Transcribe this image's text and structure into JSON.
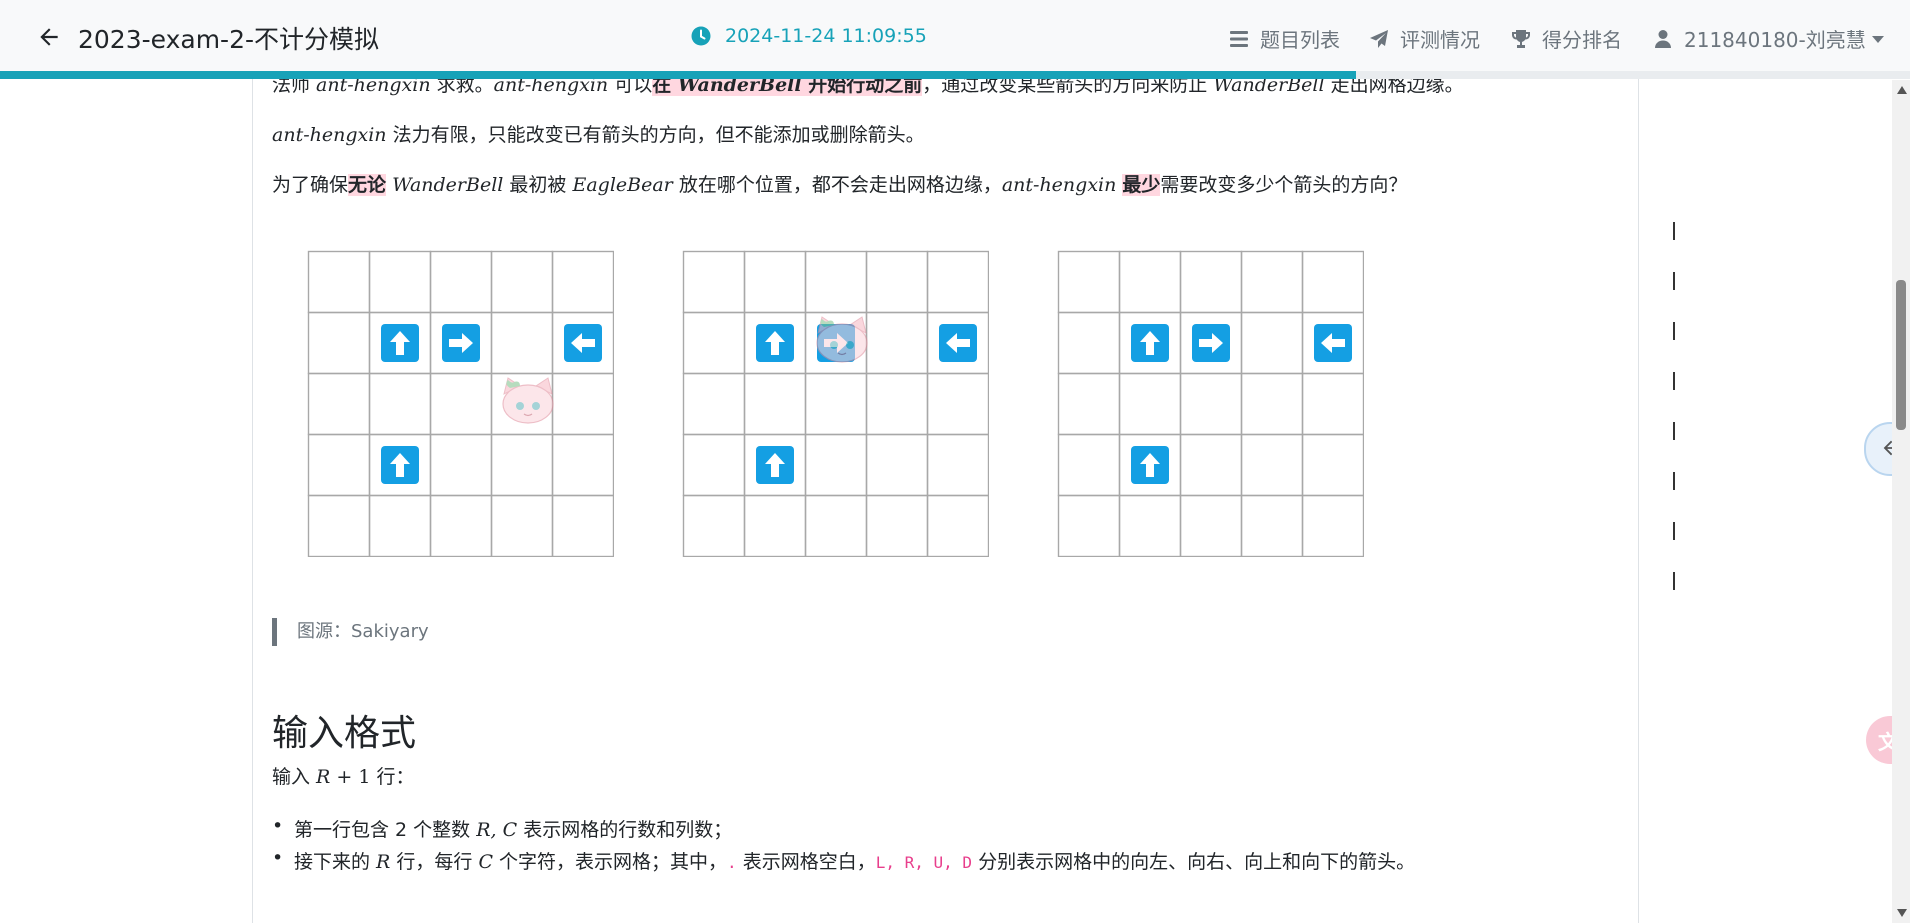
{
  "header": {
    "title": "2023-exam-2-不计分模拟",
    "clock": "2024-11-24 11:09:55",
    "nav": {
      "problems": "题目列表",
      "judge": "评测情况",
      "rank": "得分排名",
      "user": "211840180-刘亮慧"
    },
    "progress_fraction": 0.71
  },
  "problem": {
    "p1": {
      "a": "法师 ",
      "b": "ant-hengxin",
      "c": " 求救。",
      "d": "ant-hengxin",
      "e": " 可以",
      "f": "在 ",
      "g": "WanderBell",
      "h": " 开始行动之前",
      "i": "，通过改变某些箭头的方向来防止 ",
      "j": "WanderBell",
      "k": " 走出网格边缘。"
    },
    "p2": {
      "a": "ant-hengxin",
      "b": " 法力有限，只能改变已有箭头的方向，但不能添加或删除箭头。"
    },
    "p3": {
      "a": "为了确保",
      "b": "无论",
      "c": " ",
      "d": "WanderBell",
      "e": " 最初被 ",
      "f": "EagleBear",
      "g": " 放在哪个位置，都不会走出网格边缘，",
      "h": "ant-hengxin",
      "i": " ",
      "j": "最少",
      "k": "需要改变多少个箭头的方向？"
    },
    "image_caption": "图源：Sakiyary",
    "input_heading": "输入格式",
    "input_line": {
      "a": "输入 ",
      "b": "R",
      "c": " + 1",
      "d": " 行："
    },
    "bullets": {
      "b1": {
        "a": "第一行包含 2 个整数 ",
        "b": "R, C",
        "c": " 表示网格的行数和列数；"
      },
      "b2": {
        "a": "接下来的 ",
        "b": "R",
        "c": " 行，每行 ",
        "d": "C",
        "e": " 个字符，表示网格；其中，",
        "f": ".",
        "g": " 表示网格空白，",
        "h": "L, R, U, D",
        "i": " 分别表示网格中的向左、向右、向上和向下的箭头。"
      }
    }
  },
  "grids": [
    {
      "rows": 5,
      "cols": 5,
      "arrows": [
        [
          1,
          1,
          "U"
        ],
        [
          1,
          2,
          "R"
        ],
        [
          1,
          4,
          "L"
        ],
        [
          3,
          1,
          "U"
        ]
      ],
      "cat": [
        2,
        3
      ]
    },
    {
      "rows": 5,
      "cols": 5,
      "arrows": [
        [
          1,
          1,
          "U"
        ],
        [
          1,
          2,
          "R"
        ],
        [
          1,
          4,
          "L"
        ],
        [
          3,
          1,
          "U"
        ]
      ],
      "cat": [
        1,
        2
      ]
    },
    {
      "rows": 5,
      "cols": 5,
      "arrows": [
        [
          1,
          1,
          "U"
        ],
        [
          1,
          2,
          "R"
        ],
        [
          1,
          4,
          "L"
        ],
        [
          3,
          1,
          "U"
        ]
      ],
      "cat": null
    }
  ],
  "icons": {
    "back": "arrow-left-icon",
    "clock": "clock-icon",
    "list": "list-icon",
    "send": "paper-plane-icon",
    "trophy": "trophy-icon",
    "user": "user-icon",
    "sidebar_toggle": "arrow-left-icon",
    "translate": "translate-icon"
  },
  "colors": {
    "accent": "#17a2b8",
    "arrow": "#149fe3",
    "highlight": "#ffd7e0"
  }
}
